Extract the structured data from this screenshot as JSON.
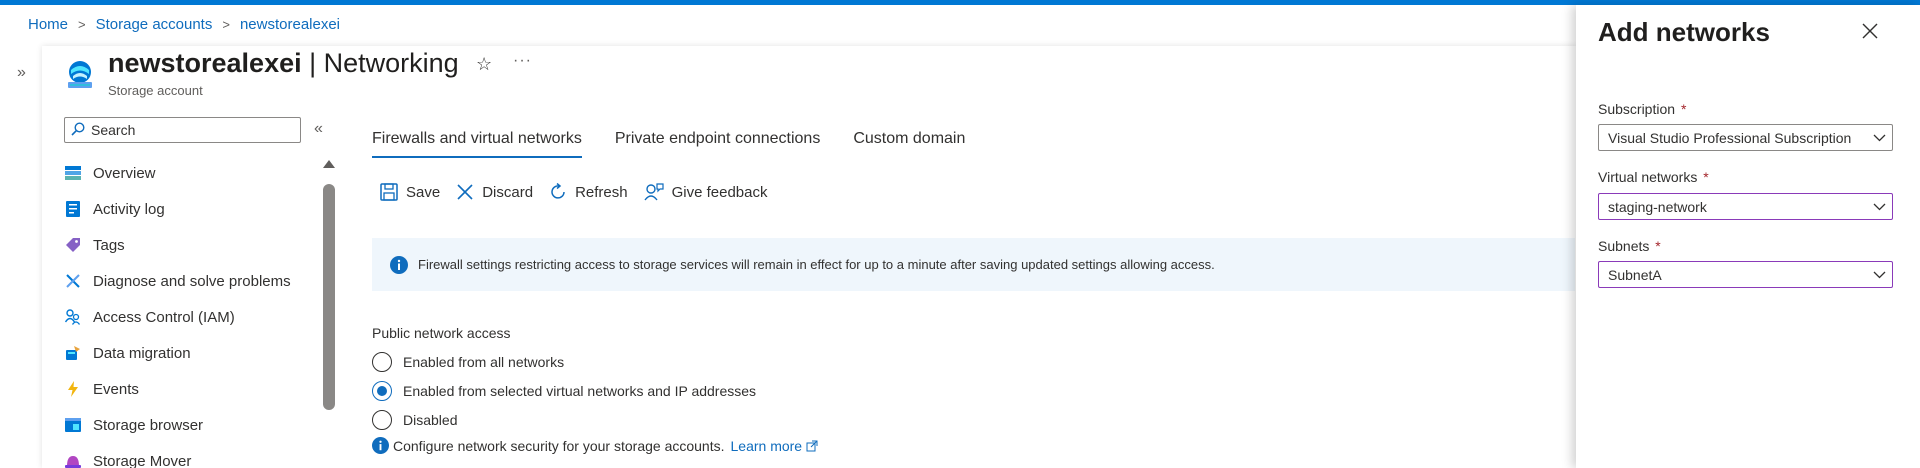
{
  "breadcrumb": [
    "Home",
    "Storage accounts",
    "newstorealexei"
  ],
  "resource": {
    "name": "newstorealexei",
    "section": "Networking",
    "separator": " | ",
    "subtitle": "Storage account",
    "icon": "storage-account-icon"
  },
  "search": {
    "placeholder": "Search"
  },
  "nav": [
    {
      "label": "Overview",
      "icon": "overview-icon"
    },
    {
      "label": "Activity log",
      "icon": "activity-log-icon"
    },
    {
      "label": "Tags",
      "icon": "tag-icon"
    },
    {
      "label": "Diagnose and solve problems",
      "icon": "wrench-icon"
    },
    {
      "label": "Access Control (IAM)",
      "icon": "people-icon"
    },
    {
      "label": "Data migration",
      "icon": "data-migration-icon"
    },
    {
      "label": "Events",
      "icon": "lightning-icon"
    },
    {
      "label": "Storage browser",
      "icon": "storage-browser-icon"
    },
    {
      "label": "Storage Mover",
      "icon": "storage-mover-icon"
    }
  ],
  "tabs": [
    "Firewalls and virtual networks",
    "Private endpoint connections",
    "Custom domain"
  ],
  "active_tab": "Firewalls and virtual networks",
  "toolbar": {
    "save": "Save",
    "discard": "Discard",
    "refresh": "Refresh",
    "feedback": "Give feedback"
  },
  "info_banner": "Firewall settings restricting access to storage services will remain in effect for up to a minute after saving updated settings allowing access.",
  "public_network_access": {
    "label": "Public network access",
    "options": [
      "Enabled from all networks",
      "Enabled from selected virtual networks and IP addresses",
      "Disabled"
    ],
    "selected": "Enabled from selected virtual networks and IP addresses"
  },
  "configure_note": {
    "text": "Configure network security for your storage accounts.",
    "link": "Learn more"
  },
  "panel": {
    "title": "Add networks",
    "subscription": {
      "label": "Subscription",
      "required_mark": "*",
      "value": "Visual Studio Professional Subscription"
    },
    "virtual_networks": {
      "label": "Virtual networks",
      "required_mark": "*",
      "value": "staging-network"
    },
    "subnets": {
      "label": "Subnets",
      "required_mark": "*",
      "value": "SubnetA"
    }
  },
  "colors": {
    "accent": "#0078d4",
    "link": "#0f6cbd",
    "banner_bg": "#eff6fc",
    "required": "#a4262c",
    "focus_border": "#8a3ab9"
  }
}
